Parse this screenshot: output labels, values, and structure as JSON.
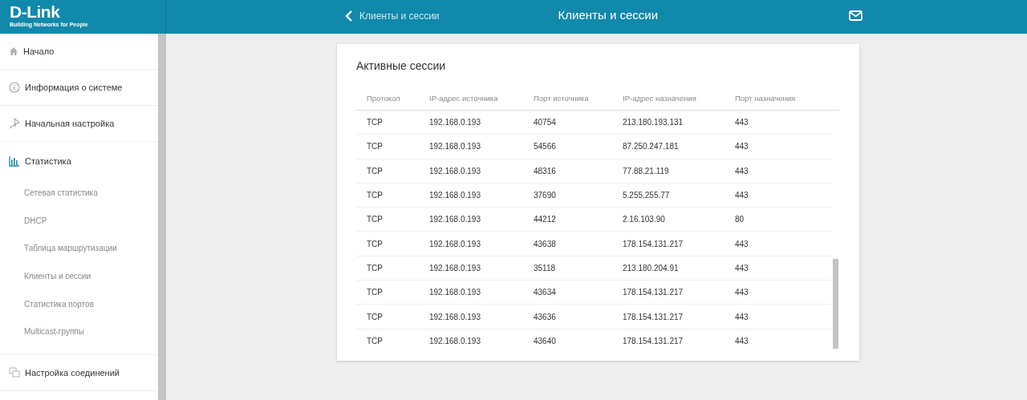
{
  "header": {
    "logo": "D-Link",
    "tagline": "Building Networks for People",
    "back_link": "Клиенты и сессии",
    "title": "Клиенты и сессии"
  },
  "sidebar": {
    "items": [
      {
        "label": "Начало"
      },
      {
        "label": "Информация о системе"
      },
      {
        "label": "Начальная настройка"
      },
      {
        "label": "Статистика",
        "children": [
          {
            "label": "Сетевая статистика"
          },
          {
            "label": "DHCP"
          },
          {
            "label": "Таблица маршрутизации"
          },
          {
            "label": "Клиенты и сессии"
          },
          {
            "label": "Статистика портов"
          },
          {
            "label": "Multicast-группы"
          }
        ]
      },
      {
        "label": "Настройка соединений"
      }
    ]
  },
  "card": {
    "title": "Активные сессии",
    "table": {
      "columns": [
        "Протокол",
        "IP-адрес источника",
        "Порт источника",
        "IP-адрес назначения",
        "Порт назначения"
      ],
      "rows": [
        [
          "TCP",
          "192.168.0.193",
          "40754",
          "213.180.193.131",
          "443"
        ],
        [
          "TCP",
          "192.168.0.193",
          "54566",
          "87.250.247.181",
          "443"
        ],
        [
          "TCP",
          "192.168.0.193",
          "48316",
          "77.88.21.119",
          "443"
        ],
        [
          "TCP",
          "192.168.0.193",
          "37690",
          "5.255.255.77",
          "443"
        ],
        [
          "TCP",
          "192.168.0.193",
          "44212",
          "2.16.103.90",
          "80"
        ],
        [
          "TCP",
          "192.168.0.193",
          "43638",
          "178.154.131.217",
          "443"
        ],
        [
          "TCP",
          "192.168.0.193",
          "35118",
          "213.180.204.91",
          "443"
        ],
        [
          "TCP",
          "192.168.0.193",
          "43634",
          "178.154.131.217",
          "443"
        ],
        [
          "TCP",
          "192.168.0.193",
          "43636",
          "178.154.131.217",
          "443"
        ],
        [
          "TCP",
          "192.168.0.193",
          "43640",
          "178.154.131.217",
          "443"
        ]
      ]
    }
  }
}
